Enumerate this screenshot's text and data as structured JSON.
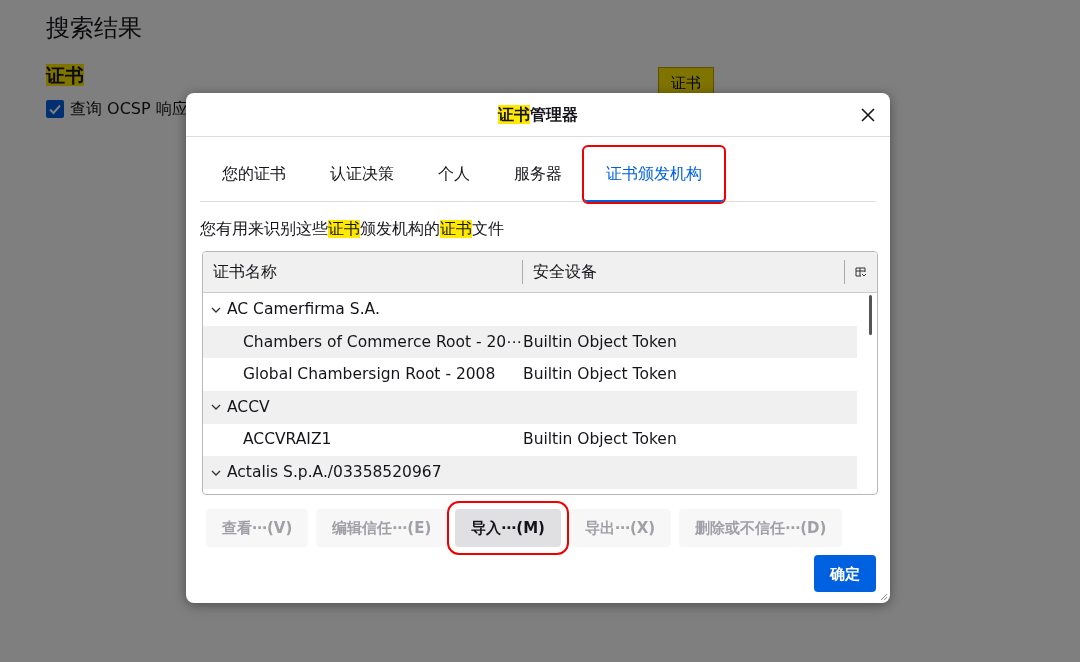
{
  "page": {
    "heading": "搜索结果",
    "section": [
      {
        "text": "证书",
        "highlighted": true
      }
    ],
    "checkbox": {
      "label": "查询 OCSP 响应",
      "checked": true
    },
    "button": {
      "label": "证书",
      "highlighted": true
    }
  },
  "dialog": {
    "title": [
      {
        "text": "证书",
        "highlighted": true
      },
      {
        "text": "管理器",
        "highlighted": false
      }
    ],
    "tabs": [
      {
        "label": "您的证书",
        "selected": false,
        "marked": false
      },
      {
        "label": "认证决策",
        "selected": false,
        "marked": false
      },
      {
        "label": "个人",
        "selected": false,
        "marked": false
      },
      {
        "label": "服务器",
        "selected": false,
        "marked": false
      },
      {
        "label": "证书颁发机构",
        "selected": true,
        "marked": true
      }
    ],
    "description": [
      {
        "text": "您有用来识别这些",
        "highlighted": false
      },
      {
        "text": "证书",
        "highlighted": true
      },
      {
        "text": "颁发机构的",
        "highlighted": false
      },
      {
        "text": "证书",
        "highlighted": true
      },
      {
        "text": "文件",
        "highlighted": false
      }
    ],
    "table": {
      "columns": [
        "证书名称",
        "安全设备"
      ],
      "rows": [
        {
          "name": "AC Camerfirma S.A.",
          "expanded": true,
          "children": [
            {
              "name": "Chambers of Commerce Root - 20⋯",
              "device": "Builtin Object Token"
            },
            {
              "name": "Global Chambersign Root - 2008",
              "device": "Builtin Object Token"
            }
          ]
        },
        {
          "name": "ACCV",
          "expanded": true,
          "children": [
            {
              "name": "ACCVRAIZ1",
              "device": "Builtin Object Token"
            }
          ]
        },
        {
          "name": "Actalis S.p.A./03358520967",
          "expanded": true
        }
      ]
    },
    "buttons": [
      {
        "label": "查看⋯(V)",
        "disabled": true,
        "marked": false
      },
      {
        "label": "编辑信任⋯(E)",
        "disabled": true,
        "marked": false
      },
      {
        "label": "导入⋯(M)",
        "disabled": false,
        "marked": true
      },
      {
        "label": "导出⋯(X)",
        "disabled": true,
        "marked": false
      },
      {
        "label": "删除或不信任⋯(D)",
        "disabled": true,
        "marked": false
      }
    ],
    "ok_button": "确定"
  }
}
